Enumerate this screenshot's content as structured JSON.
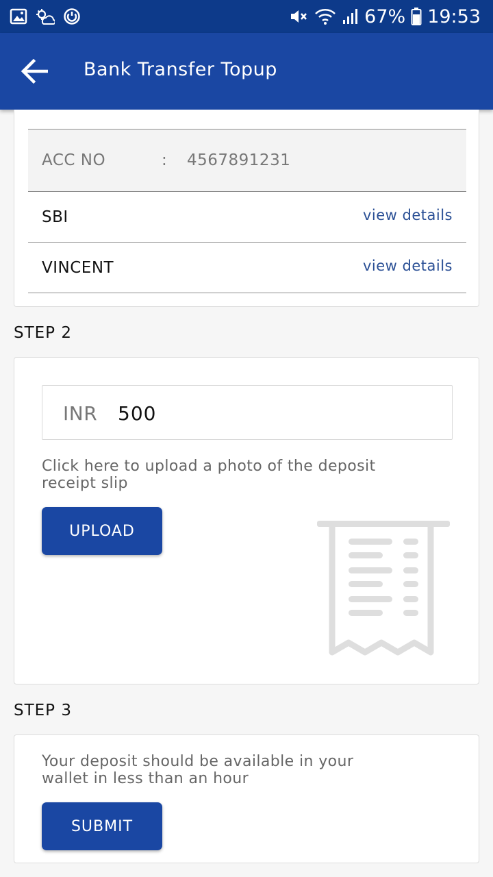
{
  "status_bar": {
    "battery": "67%",
    "time": "19:53"
  },
  "app_bar": {
    "title": "Bank Transfer Topup"
  },
  "bank_details": {
    "acc_label": "ACC NO",
    "acc_separator": ":",
    "acc_number": "4567891231",
    "rows": [
      {
        "name": "SBI",
        "link": "view details"
      },
      {
        "name": "VINCENT",
        "link": "view details"
      }
    ]
  },
  "step2": {
    "label": "STEP 2",
    "currency": "INR",
    "amount": "500",
    "help_line1": "Click here to upload a photo of the deposit",
    "help_line2": "receipt slip",
    "upload_label": "UPLOAD",
    "receipt_icon": "receipt-icon"
  },
  "step3": {
    "label": "STEP 3",
    "info_line1": "Your deposit should be available in your",
    "info_line2": "wallet in less than an hour",
    "submit_label": "SUBMIT"
  },
  "colors": {
    "status_bar": "#0d3a8a",
    "app_bar": "#1a47a3",
    "button": "#1a47a3",
    "link": "#2a4f95"
  }
}
